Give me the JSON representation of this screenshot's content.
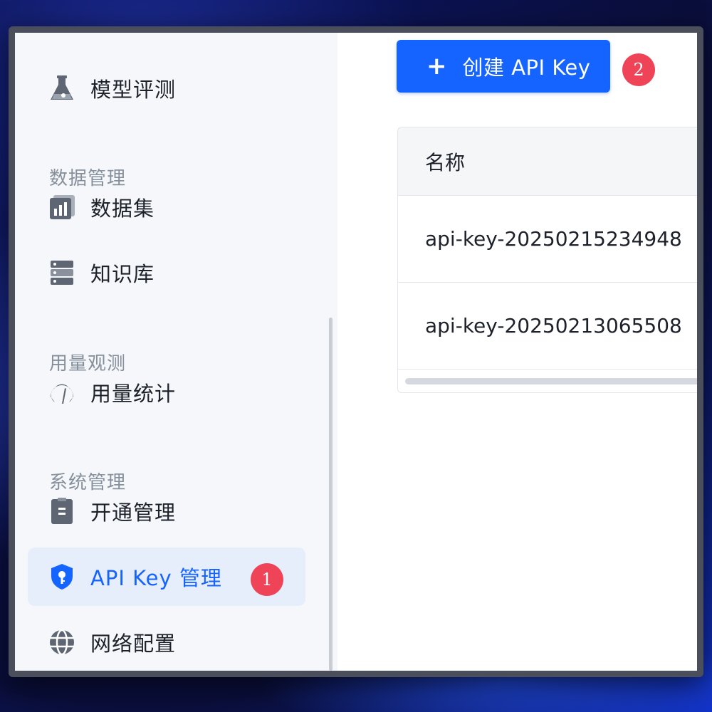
{
  "sidebar": {
    "items": [
      {
        "label": "模型评测",
        "icon": "flask-icon"
      },
      {
        "label": "数据集",
        "icon": "dataset-chart-icon"
      },
      {
        "label": "知识库",
        "icon": "server-database-icon"
      },
      {
        "label": "用量统计",
        "icon": "gauge-icon"
      },
      {
        "label": "开通管理",
        "icon": "clipboard-icon"
      },
      {
        "label": "API Key 管理",
        "icon": "shield-key-icon",
        "active": true
      },
      {
        "label": "网络配置",
        "icon": "globe-icon"
      }
    ],
    "sections": [
      "数据管理",
      "用量观测",
      "系统管理"
    ]
  },
  "main": {
    "create_button": {
      "plus": "+",
      "label": "创建 API Key"
    },
    "table": {
      "header": "名称",
      "rows": [
        "api-key-20250215234948",
        "api-key-20250213065508"
      ]
    }
  },
  "badges": {
    "step1": "1",
    "step2": "2"
  },
  "colors": {
    "accent": "#1664ff",
    "badge": "#ef4458",
    "active_bg": "#e6eefb"
  }
}
